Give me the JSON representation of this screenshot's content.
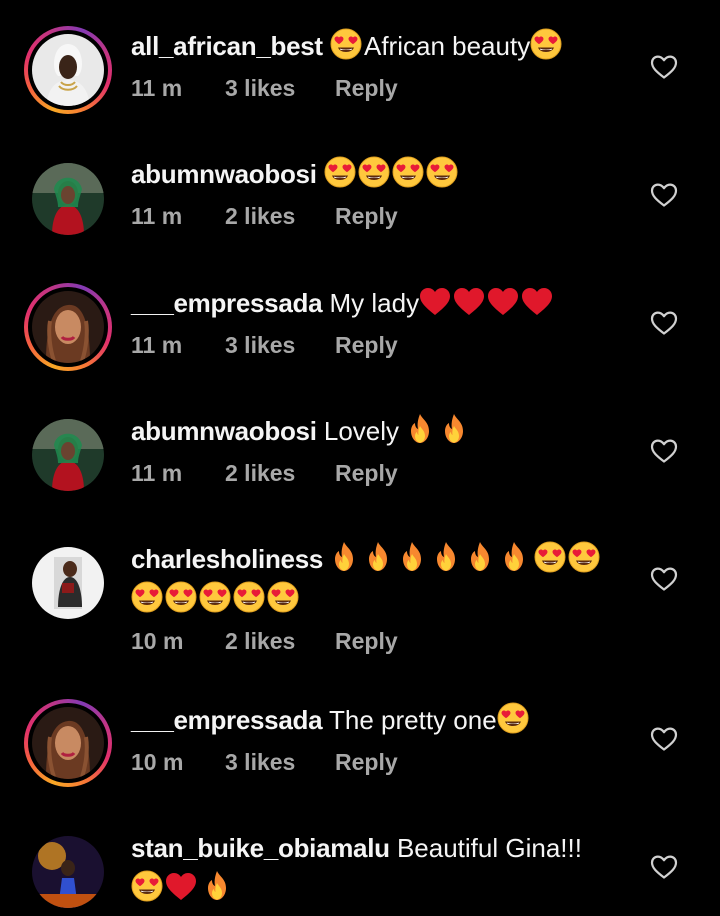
{
  "comments": [
    {
      "username": "all_african_best",
      "text": "African beauty",
      "time": "11 m",
      "likes": "3 likes",
      "reply": "Reply",
      "story_ring": true
    },
    {
      "username": "abumnwaobosi",
      "text": "",
      "time": "11 m",
      "likes": "2 likes",
      "reply": "Reply",
      "story_ring": false
    },
    {
      "username": "___empressada",
      "text": "My lady",
      "time": "11 m",
      "likes": "3 likes",
      "reply": "Reply",
      "story_ring": true
    },
    {
      "username": "abumnwaobosi",
      "text": "Lovely",
      "time": "11 m",
      "likes": "2 likes",
      "reply": "Reply",
      "story_ring": false
    },
    {
      "username": "charlesholiness",
      "text": "",
      "time": "10 m",
      "likes": "2 likes",
      "reply": "Reply",
      "story_ring": false
    },
    {
      "username": "___empressada",
      "text": "The pretty one",
      "time": "10 m",
      "likes": "3 likes",
      "reply": "Reply",
      "story_ring": true
    },
    {
      "username": "stan_buike_obiamalu",
      "text": "Beautiful Gina!!!",
      "time": "",
      "likes": "",
      "reply": "",
      "story_ring": false
    }
  ],
  "icons": {
    "like": "heart-outline-icon",
    "emoji_heart_eyes": "heart-eyes-emoji",
    "emoji_fire": "fire-emoji",
    "emoji_red_heart": "red-heart-emoji"
  },
  "colors": {
    "background": "#000000",
    "text": "#f5f5f5",
    "meta": "#a8a8a8",
    "red_heart": "#e0182b",
    "emoji_yellow": "#ffc83d"
  }
}
